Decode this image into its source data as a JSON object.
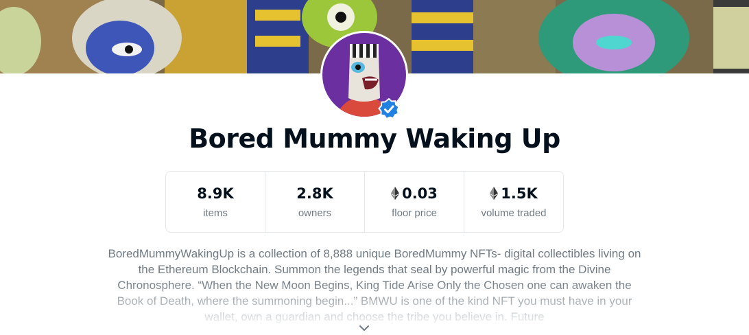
{
  "collection": {
    "title": "Bored Mummy Waking Up",
    "verified_icon": "verified-badge-icon",
    "description": "BoredMummyWakingUp is a collection of 8,888 unique BoredMummy NFTs- digital collectibles living on the Ethereum Blockchain. Summon the legends that seal by powerful magic from the Divine Chronosphere. “When the New Moon Begins, King Tide Arise Only the Chosen one can awaken the Book of Death, where the summoning begin...” BMWU is one of the kind NFT you must have in your wallet, own a guardian and choose the tribe you believe in. Future"
  },
  "stats": [
    {
      "value": "8.9K",
      "label": "items",
      "eth": false
    },
    {
      "value": "2.8K",
      "label": "owners",
      "eth": false
    },
    {
      "value": "0.03",
      "label": "floor price",
      "eth": true
    },
    {
      "value": "1.5K",
      "label": "volume traded",
      "eth": true
    }
  ],
  "icons": {
    "eth": "ethereum-icon",
    "expand": "chevron-down-icon"
  },
  "colors": {
    "verified": "#2081e2",
    "avatar_bg": "#6b2fa0",
    "text_primary": "#04111d",
    "text_secondary": "#707a83",
    "border": "#e5e8eb"
  }
}
